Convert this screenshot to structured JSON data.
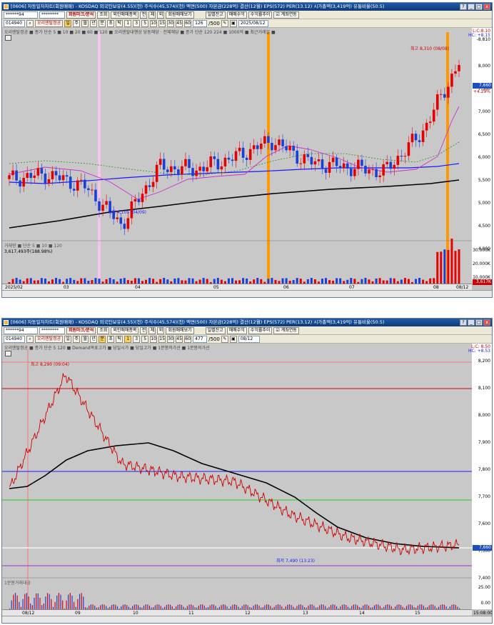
{
  "window1": {
    "title": "[0606] 자동일자차트(회원매매) - KOSDAQ 외국인보유(4.55)(천) 주식수(45,574)(천) 액면(500) 자본금(228억) 결산(12월) EPS(572) PER(13.12) 시가총액(3,419억) 유통비율(50.5)",
    "toolbar": {
      "code_input": "******94",
      "masked_input": "********",
      "buttons": [
        "회원마크/분석",
        "조회",
        "외인매매종목",
        "전",
        "체",
        "외",
        "회원매매보기"
      ],
      "mid_buttons": [
        "일별잔고",
        "매매수익",
        "수익률추이"
      ],
      "checkbox_label": "계좌연동",
      "stock_code": "014940",
      "stock_name": "오리엔탈정공",
      "period_buttons": [
        "일",
        "주",
        "월",
        "년",
        "분",
        "초",
        "틱"
      ],
      "interval_buttons": [
        "1",
        "3",
        "5",
        "10",
        "15",
        "30",
        "45",
        "60"
      ],
      "count_value": "126",
      "count_total": "/500",
      "date_value": "2025/08/12"
    },
    "legend_top": "오리엔탈정공 ■ 종가 단순 5 ■ 10 ■ 20 ■ 60 ■ 120 ■ 오리엔탈대행상 당동해당 · 전체해당 ■ 종가 단순 120 224 ■ 1000억 ■ 최근거래일 ■",
    "annotation_high": "최고 8,310 (08/08)",
    "annotation_low": "최저 4,105 (04/09)",
    "legend_volume": "거래량 ■ 단순 5 ■ 10 ■ 120",
    "volume_value": "3,617,493주(188.98%)",
    "y_labels": [
      "8,000",
      "7,500",
      "7,000",
      "6,500",
      "6,000",
      "5,500",
      "5,000",
      "4,500",
      "4,000"
    ],
    "vol_labels": [
      "30.000K",
      "20.000K",
      "10.000K"
    ],
    "top_right_labels": [
      "L:C:8.10",
      "HC: +8.15",
      "-8.810"
    ],
    "current_price": "7,660",
    "current_change": "+4.29%",
    "vol_price": "3,617K",
    "vol_pct": "189.98%",
    "x_labels": [
      "2025/02",
      "03",
      "04",
      "05",
      "06",
      "07",
      "08",
      "08/12"
    ],
    "chart_data": {
      "type": "candlestick",
      "x": [
        "2025/02",
        "03",
        "04",
        "05",
        "06",
        "07",
        "08",
        "08/12"
      ],
      "close": [
        5250,
        5350,
        5100,
        4300,
        5500,
        5450,
        5700,
        6050,
        5600,
        5500,
        5400,
        6200,
        7660
      ],
      "ylim": [
        4000,
        8300
      ],
      "high_annotation": 8310,
      "low_annotation": 4105
    }
  },
  "window2": {
    "title": "[0606] 자동일자차트(회원매매) - KOSDAQ 외국인보유(4.55)(천) 주식수(45,574)(천) 액면(500) 자본금(228억) 결산(12월) EPS(572) PER(13.12) 시가총액(3,419억) 유통비율(50.5)",
    "toolbar": {
      "code_input": "******94",
      "masked_input": "********",
      "buttons": [
        "회원마크/분석",
        "조회",
        "외인매매종목",
        "전",
        "체",
        "외",
        "회원매매보기"
      ],
      "mid_buttons": [
        "일별잔고",
        "매매수익",
        "수익률추이"
      ],
      "checkbox_label": "계좌연동",
      "stock_code": "014940",
      "stock_name": "오리엔탈정공",
      "period_buttons": [
        "일",
        "주",
        "월",
        "년",
        "분",
        "초",
        "틱"
      ],
      "interval_buttons": [
        "1",
        "3",
        "5",
        "10",
        "15",
        "30",
        "45",
        "60"
      ],
      "count_value": "477",
      "count_total": "/500",
      "date_value": "08/12"
    },
    "legend_top": "오리엔탈정공 ■ 종가 단순 5 120 ■ Demand목표고가 ■ 당일시가 ■ 당일고가 ■ 1분봉저가선 ■ 1분봉저가선",
    "annotation_high": "최고 8,290 (09:04)",
    "annotation_low": "최저 7,490 (13:23)",
    "legend_volume": "1분봉거래대금",
    "y_labels": [
      "8,200",
      "8,100",
      "8,000",
      "7,900",
      "7,800",
      "7,700",
      "7,600",
      "7,500",
      "7,400"
    ],
    "vol_labels": [
      "25.00",
      "0.00"
    ],
    "top_right_labels": [
      "L:C: 8.50",
      "HC: +8.53"
    ],
    "current_price": "7,660",
    "x_labels": [
      "08/12",
      "09",
      "10",
      "11",
      "12",
      "13",
      "14",
      "15"
    ],
    "time_label": "15:08:00",
    "chart_data": {
      "type": "line",
      "x": [
        "08/12",
        "09",
        "10",
        "11",
        "12",
        "13",
        "14",
        "15"
      ],
      "close": [
        7750,
        8200,
        7850,
        7800,
        7780,
        7650,
        7560,
        7510,
        7530
      ],
      "ylim": [
        7400,
        8300
      ],
      "high_annotation": 8290,
      "low_annotation": 7490
    }
  }
}
